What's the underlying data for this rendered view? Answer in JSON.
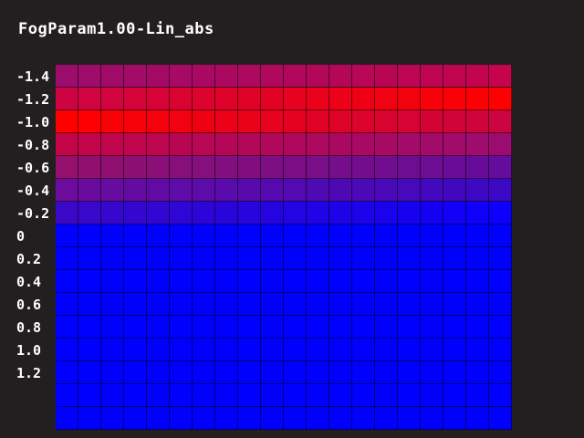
{
  "title": "FogParam1.00-Lin_abs",
  "row_labels": [
    "-1.4",
    "-1.2",
    "-1.0",
    "-0.8",
    "-0.6",
    "-0.4",
    "-0.2",
    "0",
    "0.2",
    "0.4",
    "0.6",
    "0.8",
    "1.0",
    "1.2",
    "",
    ""
  ],
  "grid": {
    "columns": 20,
    "rows": [
      {
        "left": "#9c0c6c",
        "right": "#c4044c"
      },
      {
        "left": "#cc0444",
        "right": "#ff0000"
      },
      {
        "left": "#ff0000",
        "right": "#cc0440"
      },
      {
        "left": "#c40448",
        "right": "#9c0c70"
      },
      {
        "left": "#94106c",
        "right": "#640c9c"
      },
      {
        "left": "#6c0c9c",
        "right": "#3c08c4"
      },
      {
        "left": "#3c08c8",
        "right": "#0c00fc"
      },
      {
        "left": "#0000ff",
        "right": "#0000ff"
      },
      {
        "left": "#0000ff",
        "right": "#0000ff"
      },
      {
        "left": "#0000ff",
        "right": "#0000ff"
      },
      {
        "left": "#0000ff",
        "right": "#0000ff"
      },
      {
        "left": "#0000ff",
        "right": "#0000ff"
      },
      {
        "left": "#0000ff",
        "right": "#0000ff"
      },
      {
        "left": "#0000ff",
        "right": "#0000ff"
      },
      {
        "left": "#0000ff",
        "right": "#0000ff"
      },
      {
        "left": "#0000ff",
        "right": "#0000ff"
      }
    ]
  },
  "colors": {
    "background": "#231f20",
    "text": "#ffffff"
  }
}
